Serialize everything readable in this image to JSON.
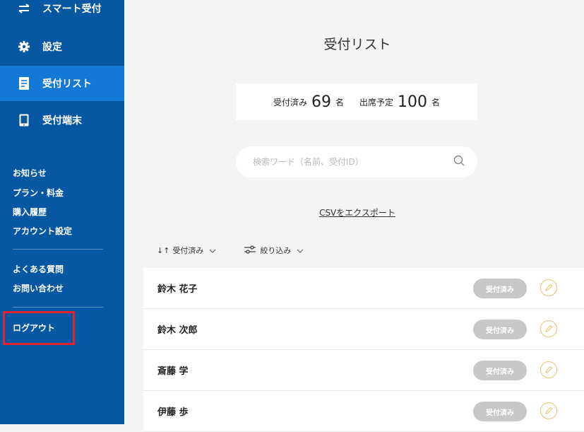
{
  "sidebar": {
    "brand": "スマート受付",
    "items": [
      {
        "label": "設定",
        "icon": "gear-icon"
      },
      {
        "label": "受付リスト",
        "icon": "document-icon",
        "active": true
      },
      {
        "label": "受付端末",
        "icon": "tablet-icon"
      }
    ],
    "links_1": [
      "お知らせ",
      "プラン・料金",
      "購入履歴",
      "アカウント設定"
    ],
    "links_2": [
      "よくある質問",
      "お問い合わせ"
    ],
    "logout": "ログアウト",
    "colors": {
      "background": "#0757a3",
      "active": "#1378d6",
      "highlight_box": "#e5242b"
    }
  },
  "main": {
    "title": "受付リスト",
    "counts": {
      "checked_in_label": "受付済み",
      "checked_in_value": "69",
      "unit": "名",
      "expected_label": "出席予定",
      "expected_value": "100"
    },
    "search": {
      "placeholder": "検索ワード（名前、受付ID）"
    },
    "csv_export": "CSVをエクスポート",
    "sort": {
      "label": "受付済み",
      "arrows": "↓↑"
    },
    "filter": {
      "label": "絞り込み"
    },
    "rows": [
      {
        "name": "鈴木 花子",
        "status": "受付済み"
      },
      {
        "name": "鈴木 次郎",
        "status": "受付済み"
      },
      {
        "name": "斎藤 学",
        "status": "受付済み"
      },
      {
        "name": "伊藤 歩",
        "status": "受付済み"
      }
    ],
    "colors": {
      "badge": "#c8c8c8",
      "edit_icon": "#e3c172"
    }
  }
}
